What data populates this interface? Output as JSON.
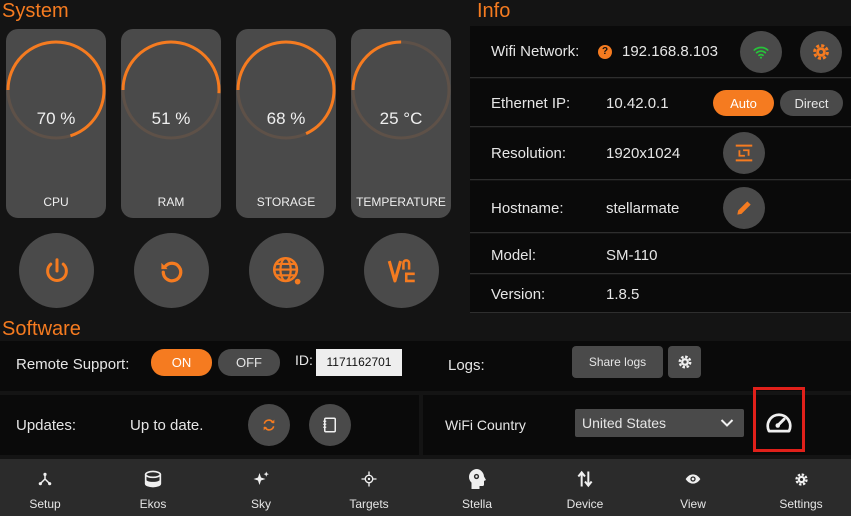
{
  "system": {
    "title": "System",
    "gauges": [
      {
        "label": "CPU",
        "value_text": "70 %",
        "value": 70
      },
      {
        "label": "RAM",
        "value_text": "51 %",
        "value": 51
      },
      {
        "label": "STORAGE",
        "value_text": "68 %",
        "value": 68
      },
      {
        "label": "TEMPERATURE",
        "value_text": "25 °C",
        "value": 25
      }
    ],
    "buttons": [
      "power-icon",
      "restart-icon",
      "globe-icon",
      "vnc-icon"
    ]
  },
  "info": {
    "title": "Info",
    "wifi": {
      "label": "Wifi Network:",
      "value": "192.168.8.103",
      "badge": "?"
    },
    "ethernet": {
      "label": "Ethernet IP:",
      "value": "10.42.0.1",
      "auto_label": "Auto",
      "direct_label": "Direct"
    },
    "resolution": {
      "label": "Resolution:",
      "value": "1920x1024"
    },
    "hostname": {
      "label": "Hostname:",
      "value": "stellarmate"
    },
    "model": {
      "label": "Model:",
      "value": "SM-110"
    },
    "version": {
      "label": "Version:",
      "value": "1.8.5"
    }
  },
  "software": {
    "title": "Software",
    "remote_support": {
      "label": "Remote Support:",
      "on_label": "ON",
      "off_label": "OFF",
      "id_label": "ID:",
      "id_value": "1171162701"
    },
    "logs": {
      "label": "Logs:",
      "share_label": "Share logs"
    },
    "updates": {
      "label": "Updates:",
      "status": "Up to date."
    },
    "wifi_country": {
      "label": "WiFi Country",
      "selected": "United States"
    }
  },
  "nav": {
    "items": [
      {
        "label": "Setup",
        "icon": "setup-icon"
      },
      {
        "label": "Ekos",
        "icon": "ekos-icon"
      },
      {
        "label": "Sky",
        "icon": "sky-icon"
      },
      {
        "label": "Targets",
        "icon": "targets-icon"
      },
      {
        "label": "Stella",
        "icon": "stella-icon"
      },
      {
        "label": "Device",
        "icon": "device-icon"
      },
      {
        "label": "View",
        "icon": "view-icon"
      },
      {
        "label": "Settings",
        "icon": "settings-icon"
      }
    ]
  },
  "colors": {
    "accent": "#f57b20",
    "card": "#4a4a4a",
    "background": "#141414",
    "highlight_box": "#e0201a"
  }
}
